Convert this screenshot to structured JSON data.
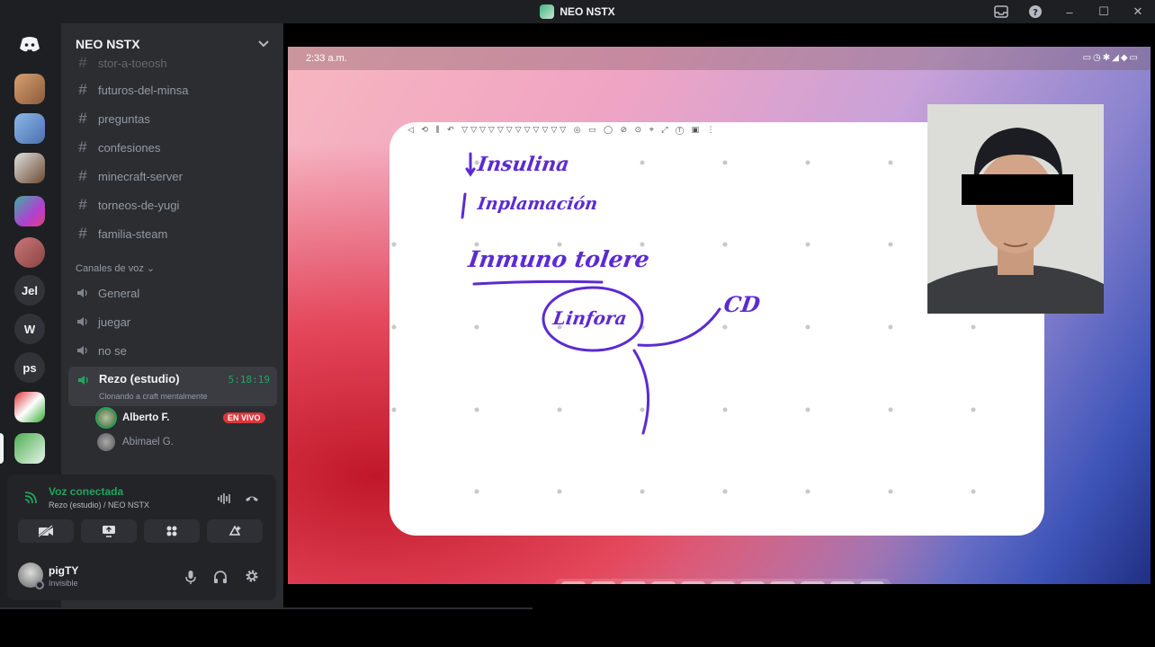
{
  "window": {
    "title": "NEO NSTX"
  },
  "rail": {
    "text_servers": [
      "Jel",
      "W",
      "ps"
    ]
  },
  "server": {
    "name": "NEO NSTX"
  },
  "channels": {
    "text": [
      "stor-a-toeosh",
      "futuros-del-minsa",
      "preguntas",
      "confesiones",
      "minecraft-server",
      "torneos-de-yugi",
      "familia-steam"
    ],
    "voice_category": "Canales de voz",
    "voice": [
      "General",
      "juegar",
      "no se"
    ],
    "active_voice": {
      "name": "Rezo (estudio)",
      "timer": "5:18:19",
      "status": "Clonando a craft mentalmente"
    },
    "voice_users": [
      {
        "name": "Alberto F.",
        "badge": "EN VIVO"
      },
      {
        "name": "Abimael G."
      }
    ]
  },
  "voice_panel": {
    "status": "Voz conectada",
    "location": "Rezo (estudio) / NEO NSTX"
  },
  "user": {
    "name": "pigTY",
    "status": "Invisible"
  },
  "stream": {
    "clock": "2:33 a.m.",
    "handwriting": [
      "Insulina",
      "Inplamación",
      "Inmuno tolere",
      "Linfora",
      "CD"
    ]
  },
  "colors": {
    "accent_green": "#23a55a",
    "live_red": "#da373c",
    "ink": "#5b2bd1"
  },
  "icons": [
    "discord-logo-icon",
    "chevron-down-icon",
    "hash-icon",
    "speaker-icon",
    "signal-icon",
    "soundboard-icon",
    "disconnect-icon",
    "camera-off-icon",
    "screen-share-icon",
    "activities-icon",
    "soundboard-sparkle-icon",
    "microphone-icon",
    "headphones-icon",
    "gear-icon",
    "inbox-icon",
    "help-icon"
  ]
}
